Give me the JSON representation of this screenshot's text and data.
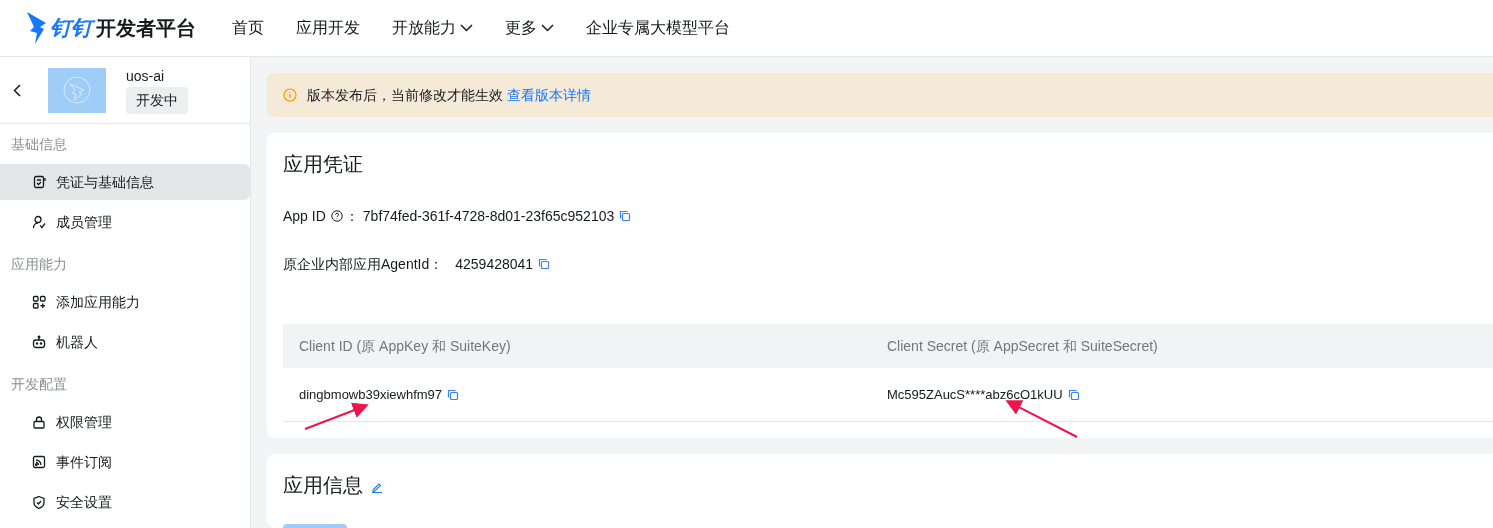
{
  "header": {
    "logo_mark": "钉钉",
    "logo_text": "开发者平台",
    "nav": [
      {
        "label": "首页",
        "dropdown": false
      },
      {
        "label": "应用开发",
        "dropdown": false
      },
      {
        "label": "开放能力",
        "dropdown": true
      },
      {
        "label": "更多",
        "dropdown": true
      },
      {
        "label": "企业专属大模型平台",
        "dropdown": false
      }
    ]
  },
  "app": {
    "name": "uos-ai",
    "status": "开发中"
  },
  "sidebar": {
    "sections": [
      {
        "title": "基础信息",
        "items": [
          {
            "label": "凭证与基础信息",
            "selected": true
          },
          {
            "label": "成员管理",
            "selected": false
          }
        ]
      },
      {
        "title": "应用能力",
        "items": [
          {
            "label": "添加应用能力",
            "selected": false
          },
          {
            "label": "机器人",
            "selected": false
          }
        ]
      },
      {
        "title": "开发配置",
        "items": [
          {
            "label": "权限管理",
            "selected": false
          },
          {
            "label": "事件订阅",
            "selected": false
          },
          {
            "label": "安全设置",
            "selected": false
          }
        ]
      }
    ]
  },
  "notice": {
    "text": "版本发布后，当前修改才能生效",
    "link": "查看版本详情"
  },
  "credentials": {
    "title": "应用凭证",
    "fields": [
      {
        "label": "App ID",
        "help": true,
        "separator": "：",
        "value": "7bf74fed-361f-4728-8d01-23f65c952103"
      },
      {
        "label": "原企业内部应用AgentId",
        "help": false,
        "separator": "：",
        "value": "4259428041"
      }
    ],
    "table": {
      "columns": [
        "Client ID (原 AppKey 和 SuiteKey)",
        "Client Secret (原 AppSecret 和 SuiteSecret)"
      ],
      "rows": [
        [
          "dingbmowb39xiewhfm97",
          "Mc595ZAucS****abz6cO1kUU"
        ]
      ]
    }
  },
  "app_info": {
    "title": "应用信息"
  }
}
